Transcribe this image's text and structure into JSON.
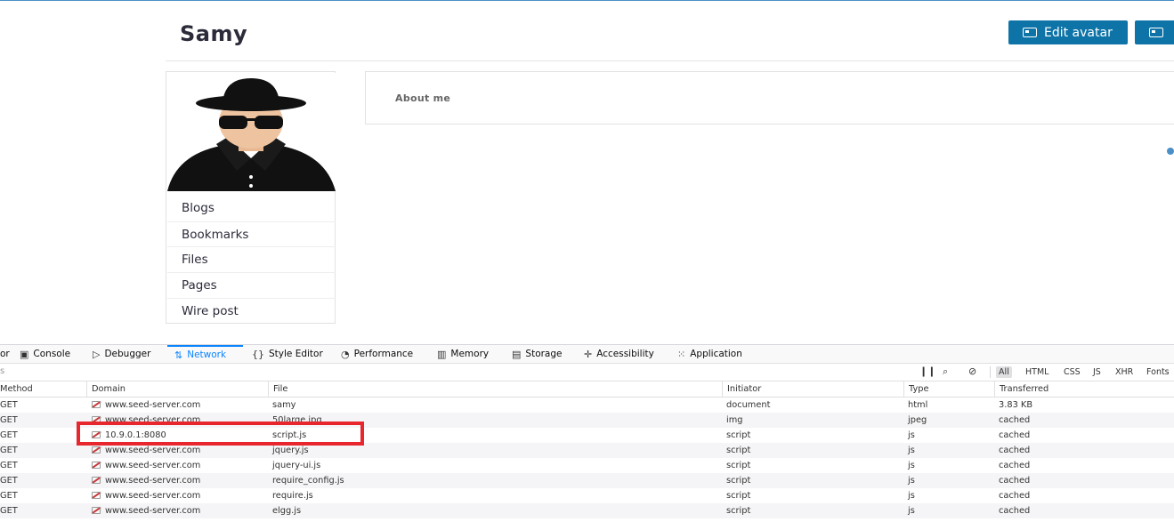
{
  "profile": {
    "name": "Samy",
    "buttons": {
      "edit_avatar": "Edit avatar",
      "edit_profile": ""
    },
    "menu": [
      "Blogs",
      "Bookmarks",
      "Files",
      "Pages",
      "Wire post"
    ],
    "about_label": "About me"
  },
  "devtools": {
    "tabs": [
      {
        "label": "Console",
        "icon": "console-icon"
      },
      {
        "label": "Debugger",
        "icon": "debugger-icon"
      },
      {
        "label": "Network",
        "icon": "network-icon",
        "active": true
      },
      {
        "label": "Style Editor",
        "icon": "style-editor-icon"
      },
      {
        "label": "Performance",
        "icon": "performance-icon"
      },
      {
        "label": "Memory",
        "icon": "memory-icon"
      },
      {
        "label": "Storage",
        "icon": "storage-icon"
      },
      {
        "label": "Accessibility",
        "icon": "accessibility-icon"
      },
      {
        "label": "Application",
        "icon": "application-icon"
      }
    ],
    "truncated_tab": "or",
    "filter_placeholder": "s",
    "type_filters": [
      "All",
      "HTML",
      "CSS",
      "JS",
      "XHR",
      "Fonts"
    ],
    "columns": [
      "Method",
      "Domain",
      "File",
      "Initiator",
      "Type",
      "Transferred"
    ],
    "rows": [
      {
        "method": "GET",
        "domain": "www.seed-server.com",
        "file": "samy",
        "initiator": "document",
        "type": "html",
        "transferred": "3.83 KB"
      },
      {
        "method": "GET",
        "domain": "www.seed-server.com",
        "file": "50large.jpg",
        "initiator": "img",
        "type": "jpeg",
        "transferred": "cached"
      },
      {
        "method": "GET",
        "domain": "10.9.0.1:8080",
        "file": "script.js",
        "initiator": "script",
        "type": "js",
        "transferred": "cached"
      },
      {
        "method": "GET",
        "domain": "www.seed-server.com",
        "file": "jquery.js",
        "initiator": "script",
        "type": "js",
        "transferred": "cached"
      },
      {
        "method": "GET",
        "domain": "www.seed-server.com",
        "file": "jquery-ui.js",
        "initiator": "script",
        "type": "js",
        "transferred": "cached"
      },
      {
        "method": "GET",
        "domain": "www.seed-server.com",
        "file": "require_config.js",
        "initiator": "script",
        "type": "js",
        "transferred": "cached"
      },
      {
        "method": "GET",
        "domain": "www.seed-server.com",
        "file": "require.js",
        "initiator": "script",
        "type": "js",
        "transferred": "cached"
      },
      {
        "method": "GET",
        "domain": "www.seed-server.com",
        "file": "elgg.js",
        "initiator": "script",
        "type": "js",
        "transferred": "cached"
      }
    ]
  },
  "colors": {
    "accent": "#0e74a8",
    "devtools_active": "#0a84ff",
    "highlight": "#e8262d"
  }
}
